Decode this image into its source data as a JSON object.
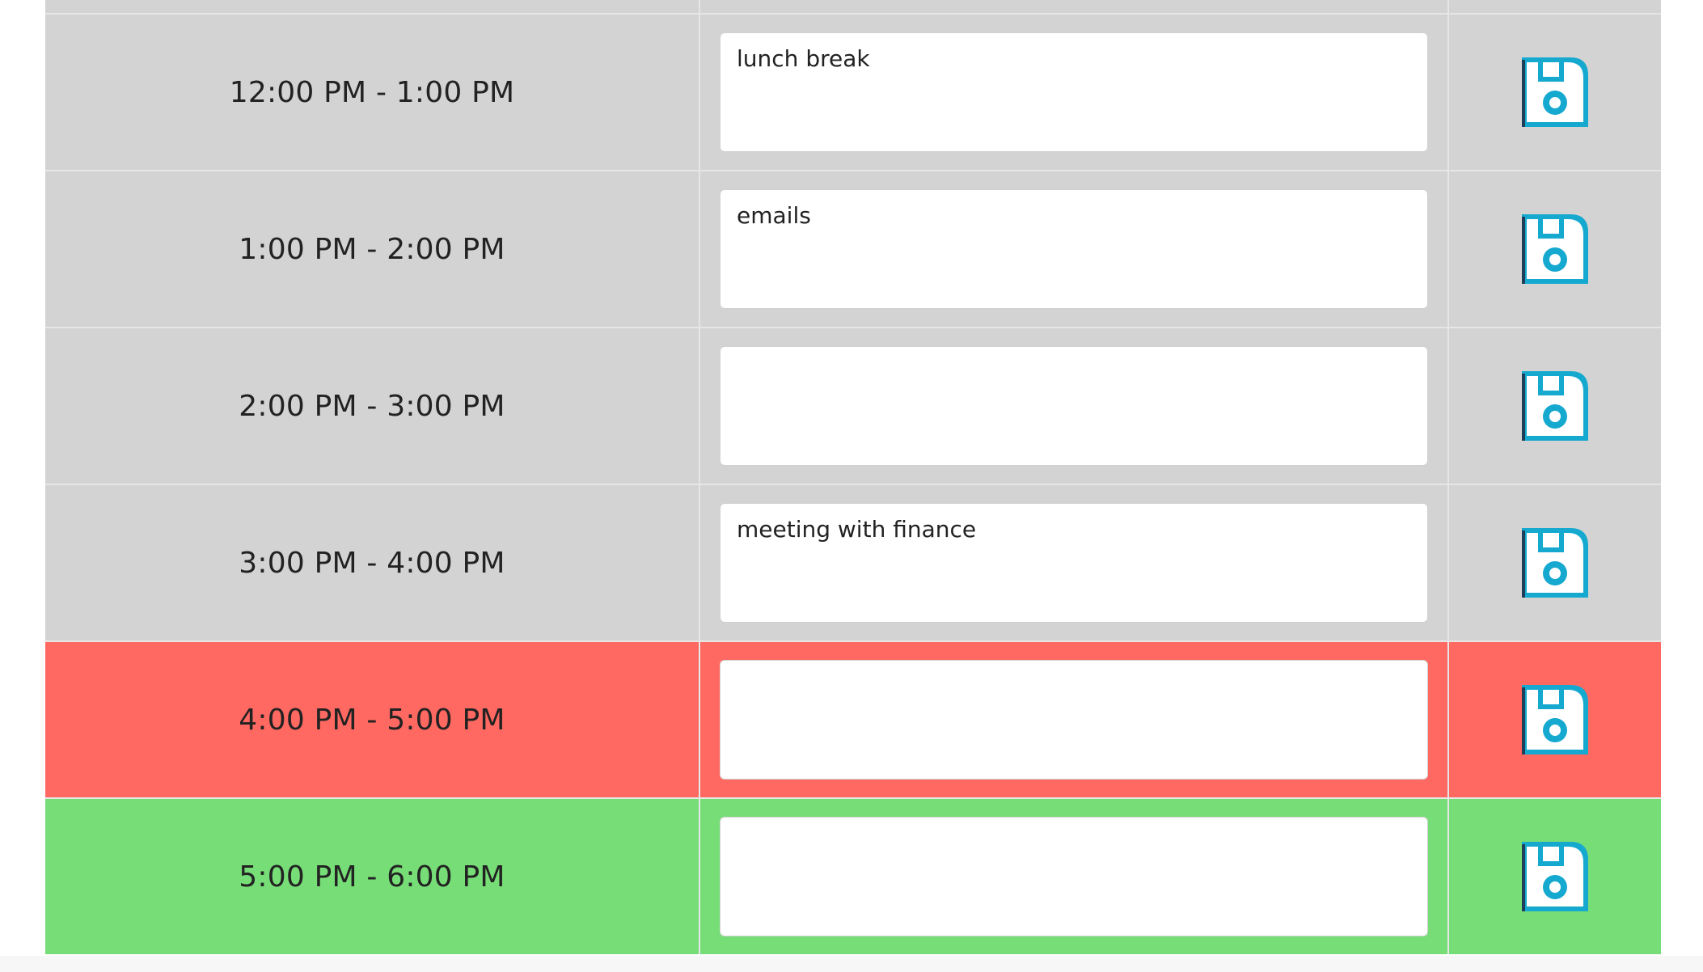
{
  "planner": {
    "rows": [
      {
        "time": "12:00 PM - 1:00 PM",
        "event": "lunch break",
        "status": "past"
      },
      {
        "time": "1:00 PM - 2:00 PM",
        "event": "emails",
        "status": "past"
      },
      {
        "time": "2:00 PM - 3:00 PM",
        "event": "",
        "status": "past"
      },
      {
        "time": "3:00 PM - 4:00 PM",
        "event": "meeting with finance",
        "status": "past"
      },
      {
        "time": "4:00 PM - 5:00 PM",
        "event": "",
        "status": "present"
      },
      {
        "time": "5:00 PM - 6:00 PM",
        "event": "",
        "status": "future"
      }
    ],
    "save_icon": "floppy-disk-save-icon"
  },
  "colors": {
    "past": "#d3d3d3",
    "present": "#ff6961",
    "future": "#77dd77",
    "save_icon": "#16a9cf"
  }
}
